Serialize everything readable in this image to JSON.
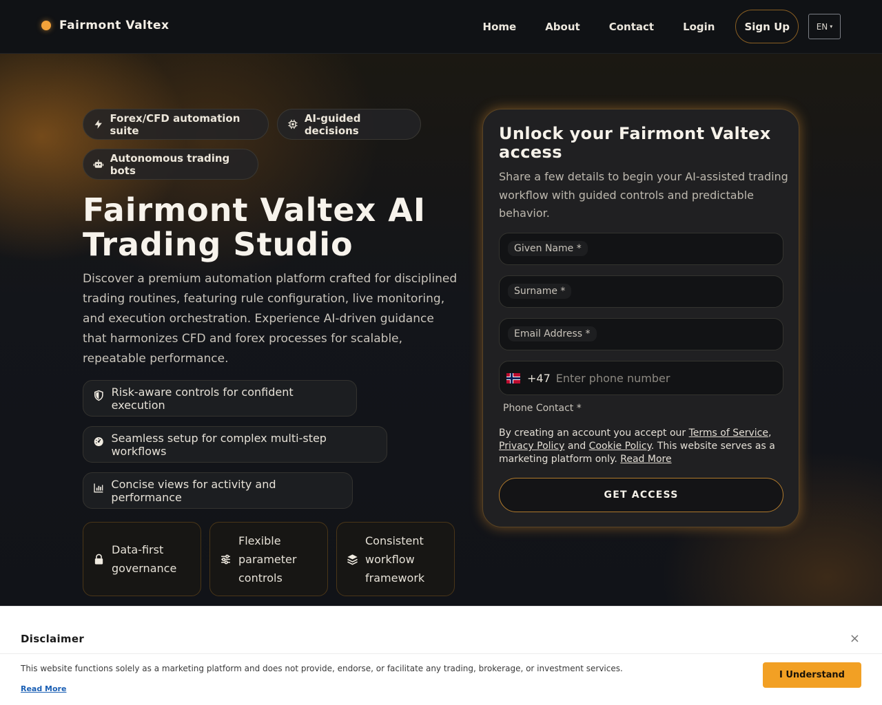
{
  "header": {
    "brand": "Fairmont Valtex",
    "nav": [
      "Home",
      "About",
      "Contact",
      "Login"
    ],
    "signup": "Sign Up",
    "lang": "EN",
    "lang_caret": "▾"
  },
  "hero": {
    "pills": [
      "Forex/CFD automation suite",
      "AI-guided decisions",
      "Autonomous trading bots"
    ],
    "title": "Fairmont Valtex AI Trading Studio",
    "lead": "Discover a premium automation platform crafted for disciplined trading routines, featuring rule configuration, live monitoring, and execution orchestration. Experience AI-driven guidance that harmonizes CFD and forex processes for scalable, repeatable performance.",
    "features": [
      "Risk-aware controls for confident execution",
      "Seamless setup for complex multi-step workflows",
      "Concise views for activity and performance"
    ],
    "cards": [
      "Data-first governance",
      "Flexible parameter controls",
      "Consistent workflow framework"
    ]
  },
  "form": {
    "title": "Unlock your Fairmont Valtex access",
    "subtitle": "Share a few details to begin your AI-assisted trading workflow with guided controls and predictable behavior.",
    "given_name": "Given Name *",
    "surname": "Surname *",
    "email": "Email Address *",
    "phone_code": "+47",
    "phone_placeholder": "Enter phone number",
    "phone_label": "Phone Contact *",
    "legal_1": "By creating an account you accept our ",
    "terms": "Terms of Service",
    "legal_2": ", ",
    "privacy": "Privacy Policy",
    "legal_3": " and ",
    "cookie": "Cookie Policy",
    "legal_4": ". This website serves as a marketing platform only. ",
    "read_more": "Read More",
    "submit": "GET ACCESS"
  },
  "disclaimer": {
    "title": "Disclaimer",
    "close": "×",
    "text": "This website functions solely as a marketing platform and does not provide, endorse, or facilitate any trading, brokerage, or investment services.",
    "read_more": "Read More",
    "button": "I Understand"
  },
  "colors": {
    "accent": "#f2a23a",
    "button_orange": "#f2a024",
    "link_blue": "#1a5fb4"
  },
  "icons": [
    "bolt-icon",
    "chip-icon",
    "robot-icon",
    "shield-icon",
    "gauge-icon",
    "bar-chart-icon",
    "lock-icon",
    "sliders-icon",
    "layers-icon",
    "norway-flag-icon",
    "close-icon"
  ]
}
